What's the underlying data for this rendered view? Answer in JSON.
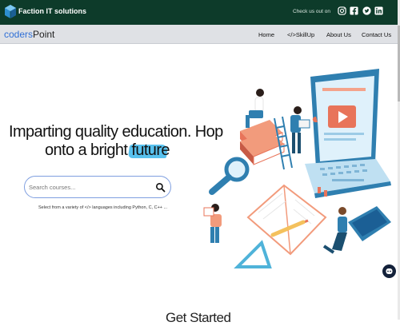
{
  "topbar": {
    "brand_name": "Faction IT solutions",
    "social_label": "Check us out on",
    "social_icons": [
      "instagram-icon",
      "facebook-icon",
      "twitter-icon",
      "linkedin-icon"
    ],
    "background": "#0d3b2a"
  },
  "navbar": {
    "logo_part1": "coders",
    "logo_part2": "Point",
    "links": [
      "Home",
      "</>SkillUp",
      "About Us",
      "Contact Us"
    ],
    "background": "#dfe1e5"
  },
  "hero": {
    "line1": "Imparting quality education. Hop",
    "line2_prefix": "onto a bright ",
    "line2_highlight": "future",
    "highlight_color": "#58c1ee"
  },
  "search": {
    "placeholder": "Search courses...",
    "value": ""
  },
  "hint": "Select from a variety of </> languages including Python, C, C++ ...",
  "section": {
    "title": "Get Started"
  },
  "colors": {
    "accent_blue": "#2f6fd6",
    "illustration_orange": "#e8745a",
    "illustration_blue": "#2f7fb0",
    "chat_bubble": "#13213a"
  }
}
